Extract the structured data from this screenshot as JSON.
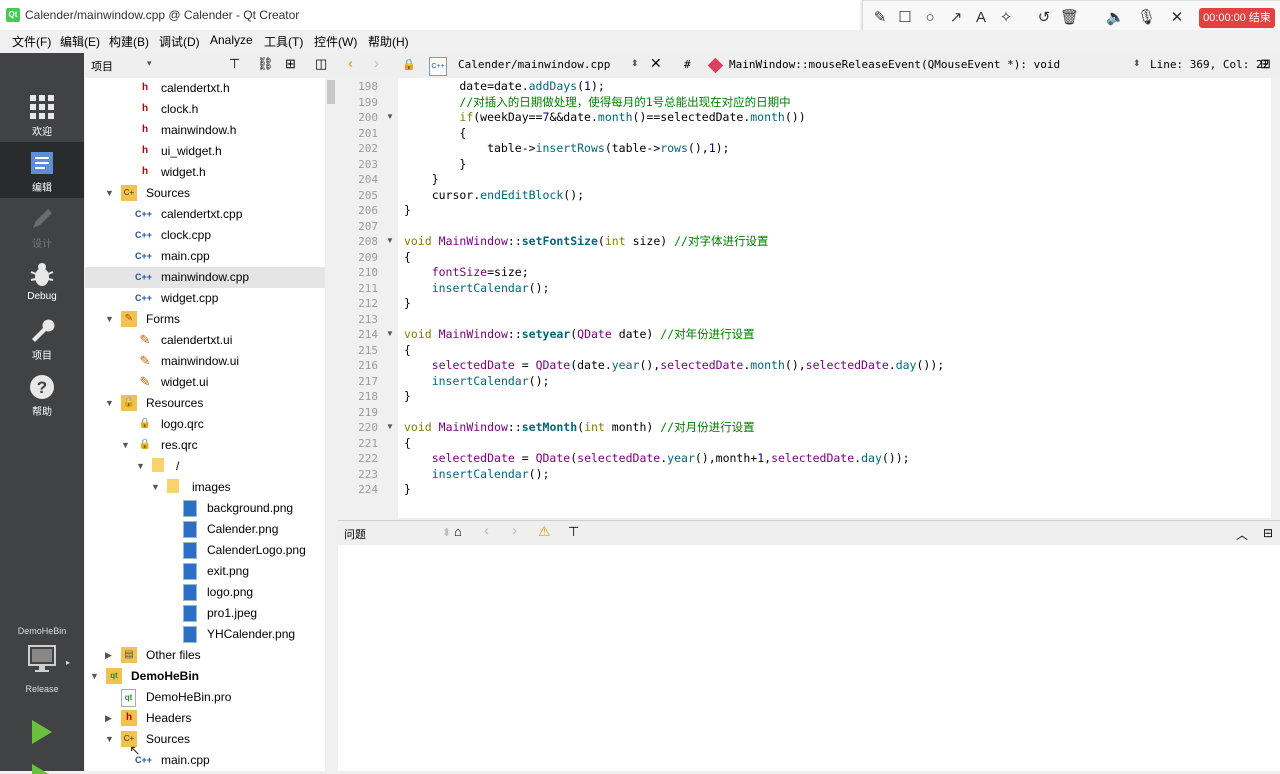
{
  "window": {
    "title": "Calender/mainwindow.cpp @ Calender - Qt Creator"
  },
  "recorder": {
    "end_label": "00:00:00 结束"
  },
  "menu": [
    "文件(F)",
    "编辑(E)",
    "构建(B)",
    "调试(D)",
    "Analyze",
    "工具(T)",
    "控件(W)",
    "帮助(H)"
  ],
  "project_pane": {
    "title": "项目"
  },
  "editor_toolbar": {
    "file_path": "Calender/mainwindow.cpp",
    "hash": "#",
    "symbol": "MainWindow::mouseReleaseEvent(QMouseEvent *): void",
    "position": "Line: 369, Col: 22"
  },
  "modes": {
    "welcome": "欢迎",
    "edit": "编辑",
    "design": "设计",
    "debug": "Debug",
    "projects": "项目",
    "help": "帮助"
  },
  "kit": {
    "project": "DemoHeBin",
    "config": "Release"
  },
  "tree": [
    {
      "label": "calendertxt.h",
      "icon": "header-icon"
    },
    {
      "label": "clock.h",
      "icon": "header-icon"
    },
    {
      "label": "mainwindow.h",
      "icon": "header-icon"
    },
    {
      "label": "ui_widget.h",
      "icon": "header-icon"
    },
    {
      "label": "widget.h",
      "icon": "header-icon"
    },
    {
      "label": "Sources",
      "icon": "sources-folder-icon"
    },
    {
      "label": "calendertxt.cpp",
      "icon": "cpp-icon"
    },
    {
      "label": "clock.cpp",
      "icon": "cpp-icon"
    },
    {
      "label": "main.cpp",
      "icon": "cpp-icon"
    },
    {
      "label": "mainwindow.cpp",
      "icon": "cpp-icon"
    },
    {
      "label": "widget.cpp",
      "icon": "cpp-icon"
    },
    {
      "label": "Forms",
      "icon": "forms-folder-icon"
    },
    {
      "label": "calendertxt.ui",
      "icon": "ui-form-icon"
    },
    {
      "label": "mainwindow.ui",
      "icon": "ui-form-icon"
    },
    {
      "label": "widget.ui",
      "icon": "ui-form-icon"
    },
    {
      "label": "Resources",
      "icon": "resources-folder-icon"
    },
    {
      "label": "logo.qrc",
      "icon": "qrc-icon"
    },
    {
      "label": "res.qrc",
      "icon": "qrc-icon"
    },
    {
      "label": "/",
      "icon": "folder-icon"
    },
    {
      "label": "images",
      "icon": "folder-icon"
    },
    {
      "label": "background.png",
      "icon": "image-file-icon"
    },
    {
      "label": "Calender.png",
      "icon": "image-file-icon"
    },
    {
      "label": "CalenderLogo.png",
      "icon": "image-file-icon"
    },
    {
      "label": "exit.png",
      "icon": "image-file-icon"
    },
    {
      "label": "logo.png",
      "icon": "image-file-icon"
    },
    {
      "label": "pro1.jpeg",
      "icon": "image-file-icon"
    },
    {
      "label": "YHCalender.png",
      "icon": "image-file-icon"
    },
    {
      "label": "Other files",
      "icon": "other-files-icon"
    },
    {
      "label": "DemoHeBin",
      "icon": "project-icon"
    },
    {
      "label": "DemoHeBin.pro",
      "icon": "pro-file-icon"
    },
    {
      "label": "Headers",
      "icon": "headers-folder-icon"
    },
    {
      "label": "Sources",
      "icon": "sources-folder-icon"
    },
    {
      "label": "main.cpp",
      "icon": "cpp-icon"
    }
  ],
  "editor": {
    "line_numbers": [
      "198",
      "199",
      "200",
      "201",
      "202",
      "203",
      "204",
      "205",
      "206",
      "207",
      "208",
      "209",
      "210",
      "211",
      "212",
      "213",
      "214",
      "215",
      "216",
      "217",
      "218",
      "219",
      "220",
      "221",
      "222",
      "223",
      "224"
    ]
  },
  "output_pane": {
    "title": "问题"
  },
  "colors": {
    "mode_bar": "#404244",
    "selection": "#e5e5e5",
    "keyword": "#808000",
    "comment": "#008000",
    "function": "#00677c",
    "type": "#800080"
  }
}
